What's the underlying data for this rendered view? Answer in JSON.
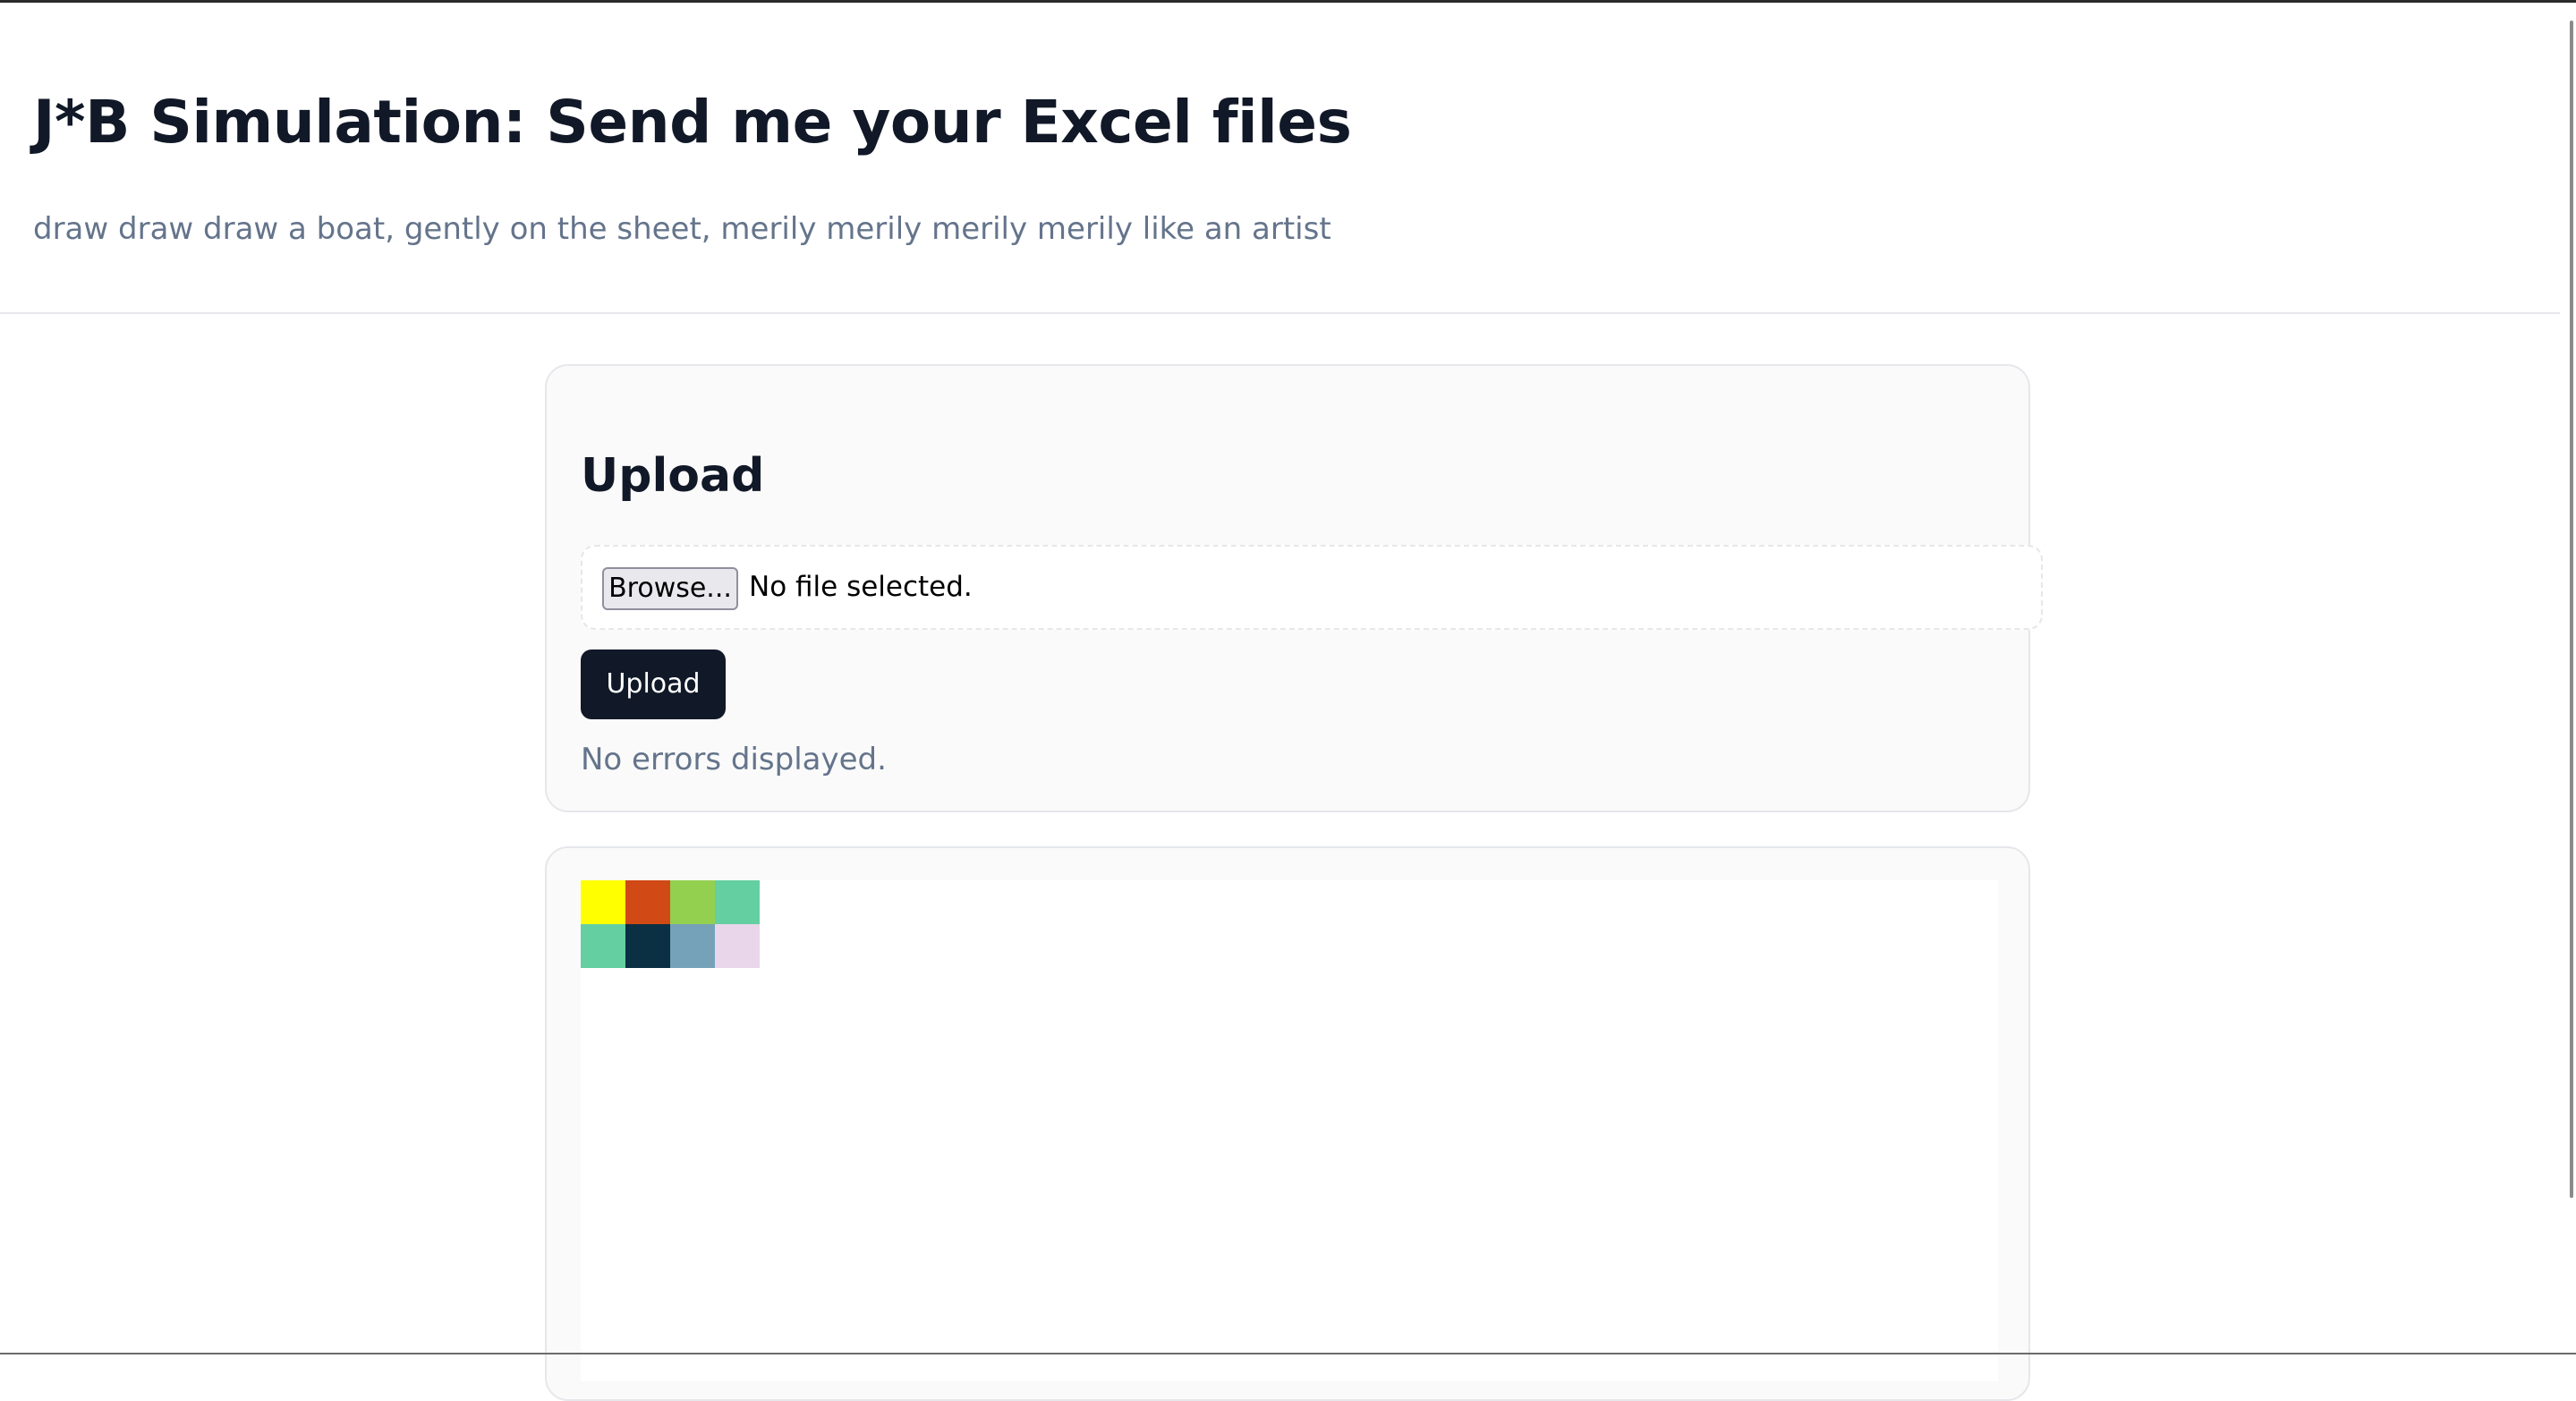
{
  "header": {
    "title": "J*B Simulation: Send me your Excel files",
    "subtitle": "draw draw draw a boat, gently on the sheet, merily merily merily merily like an artist"
  },
  "upload": {
    "heading": "Upload",
    "browse_label": "Browse...",
    "file_status": "No file selected.",
    "upload_label": "Upload",
    "error_text": "No errors displayed."
  },
  "canvas": {
    "swatches": [
      {
        "color": "#ffff00"
      },
      {
        "color": "#d14914"
      },
      {
        "color": "#93d050"
      },
      {
        "color": "#64cfa1"
      },
      {
        "color": "#64cfa1"
      },
      {
        "color": "#0b2f43"
      },
      {
        "color": "#75a2b9"
      },
      {
        "color": "#ead6ea"
      }
    ]
  }
}
